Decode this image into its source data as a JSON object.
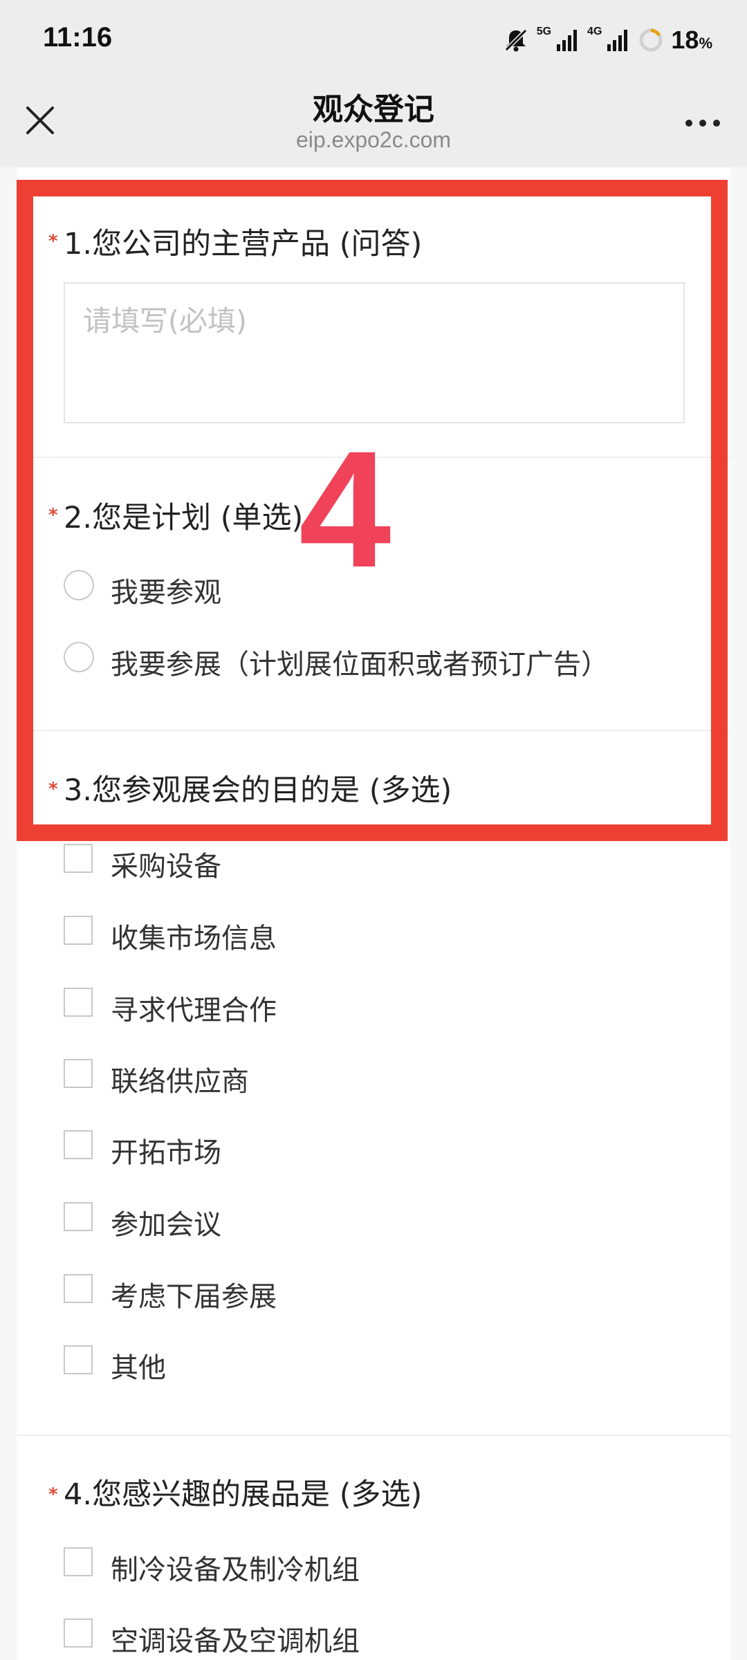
{
  "status_bar": {
    "time": "11:16",
    "network_1": "5G",
    "network_2": "4G",
    "battery_percent": "18",
    "battery_unit": "%"
  },
  "nav": {
    "title": "观众登记",
    "url": "eip.expo2c.com",
    "icons": [
      "close-icon",
      "more-icon"
    ]
  },
  "form": {
    "required_mark": "*",
    "q1": {
      "title": "1.您公司的主营产品 (问答)",
      "placeholder": "请填写(必填)"
    },
    "q2": {
      "title": "2.您是计划 (单选)",
      "options": [
        "我要参观",
        "我要参展（计划展位面积或者预订广告）"
      ]
    },
    "q3": {
      "title": "3.您参观展会的目的是 (多选)",
      "options": [
        "采购设备",
        "收集市场信息",
        "寻求代理合作",
        "联络供应商",
        "开拓市场",
        "参加会议",
        "考虑下届参展",
        "其他"
      ]
    },
    "q4": {
      "title": "4.您感兴趣的展品是 (多选)",
      "options": [
        "制冷设备及制冷机组",
        "空调设备及空调机组"
      ]
    }
  },
  "annotation": {
    "label": "4",
    "colors": {
      "box": "#ee4032",
      "label": "#f0435a"
    }
  }
}
